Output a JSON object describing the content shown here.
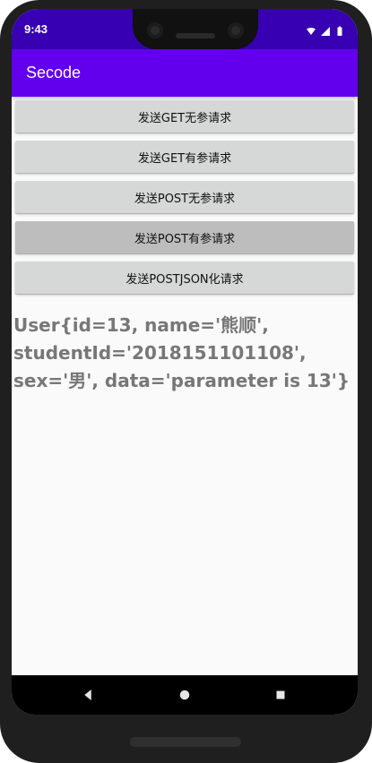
{
  "status_bar": {
    "time": "9:43",
    "icons": [
      "wifi-icon",
      "signal-icon",
      "battery-icon"
    ]
  },
  "app_bar": {
    "title": "Secode"
  },
  "buttons": [
    {
      "label": "发送GET无参请求",
      "pressed": false
    },
    {
      "label": "发送GET有参请求",
      "pressed": false
    },
    {
      "label": "发送POST无参请求",
      "pressed": false
    },
    {
      "label": "发送POST有参请求",
      "pressed": true
    },
    {
      "label": "发送POSTJSON化请求",
      "pressed": false
    }
  ],
  "result_text": "User{id=13, name='熊顺', studentId='2018151101108', sex='男', data='parameter is 13'}",
  "colors": {
    "status_bar": "#3700b3",
    "app_bar": "#6200ee",
    "button_bg": "#d6d7d7",
    "button_pressed": "#bdbdbd",
    "result_text": "#777777"
  },
  "nav_bar": {
    "buttons": [
      "back-icon",
      "home-icon",
      "recent-apps-icon"
    ]
  }
}
